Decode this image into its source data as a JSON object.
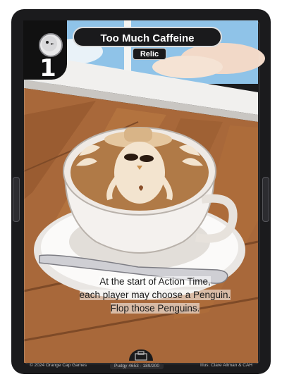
{
  "card": {
    "title": "Too Much Caffeine",
    "subtype": "Relic",
    "cost": "1",
    "type_icon": "penguin-head-icon",
    "rules_lines": [
      "At the start of Action Time,",
      "each player may choose a Penguin.",
      "Flop those Penguins."
    ],
    "footer": {
      "copyright": "© 2024 Orange Cap Games",
      "set_info": "Pudgy 4653 · 189/200",
      "illustrator": "Illus. Clare Altman & CAH"
    },
    "set_icon": "building-icon"
  },
  "colors": {
    "frame": "#1b1b1d",
    "wood": "#a8683a",
    "latte": "#b07a47",
    "cup": "#f4f1ee",
    "sky": "#8fc3e8"
  }
}
